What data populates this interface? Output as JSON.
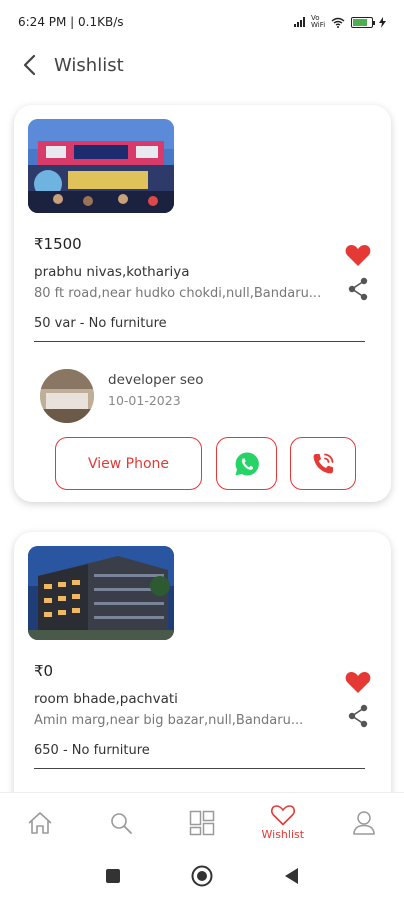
{
  "status_bar": {
    "time_speed": "6:24 PM | 0.1KB/s",
    "network": "Vo WiFi",
    "battery_level": 0.8
  },
  "header": {
    "title": "Wishlist"
  },
  "listings": [
    {
      "price": "₹1500",
      "title": "prabhu nivas,kothariya",
      "address": "80 ft road,near hudko chokdi,null,Bandaru...",
      "specs": "50 var - No furniture",
      "favorited": true,
      "agent": {
        "name": "developer seo",
        "date": "10-01-2023"
      },
      "actions": {
        "view_phone": "View Phone"
      }
    },
    {
      "price": "₹0",
      "title": "room bhade,pachvati",
      "address": "Amin marg,near big bazar,null,Bandaru...",
      "specs": "650 - No furniture",
      "favorited": true
    }
  ],
  "bottom_nav": {
    "items": [
      {
        "icon": "home-icon"
      },
      {
        "icon": "search-icon"
      },
      {
        "icon": "grid-icon"
      },
      {
        "icon": "heart-icon",
        "label": "Wishlist",
        "active": true
      },
      {
        "icon": "profile-icon"
      }
    ]
  },
  "colors": {
    "accent": "#e53935",
    "whatsapp": "#25d366"
  }
}
